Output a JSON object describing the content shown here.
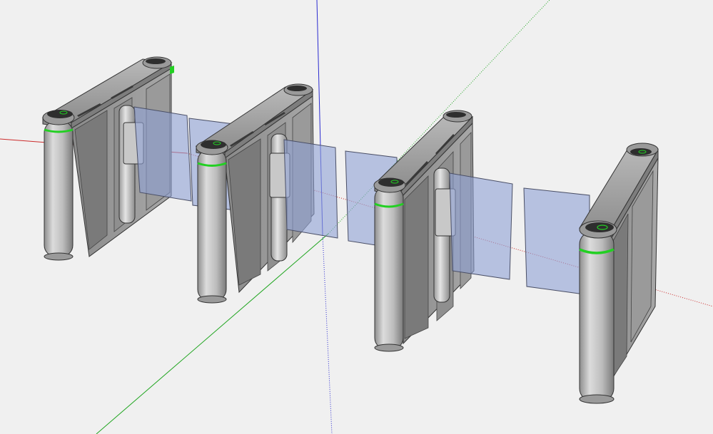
{
  "viewport": {
    "background": "#f0f0f0",
    "axis_colors": {
      "red": "#cc2a2a",
      "green": "#1fa51f",
      "blue": "#2a2ad0"
    }
  },
  "model": {
    "body_color": "#a9a9a9",
    "body_dark": "#6f6f6f",
    "top_cap_color": "#9a9a9a",
    "lcd_color": "#2e2e2e",
    "led_color": "#22d022",
    "glass_color": "#8fa2d6",
    "cabinets": [
      {
        "id": "cabinet-1"
      },
      {
        "id": "cabinet-2"
      },
      {
        "id": "cabinet-3"
      },
      {
        "id": "cabinet-4"
      }
    ],
    "glass_panels": [
      {
        "id": "glass-1"
      },
      {
        "id": "glass-2"
      },
      {
        "id": "glass-3"
      },
      {
        "id": "glass-4"
      },
      {
        "id": "glass-5"
      },
      {
        "id": "glass-6"
      }
    ]
  }
}
